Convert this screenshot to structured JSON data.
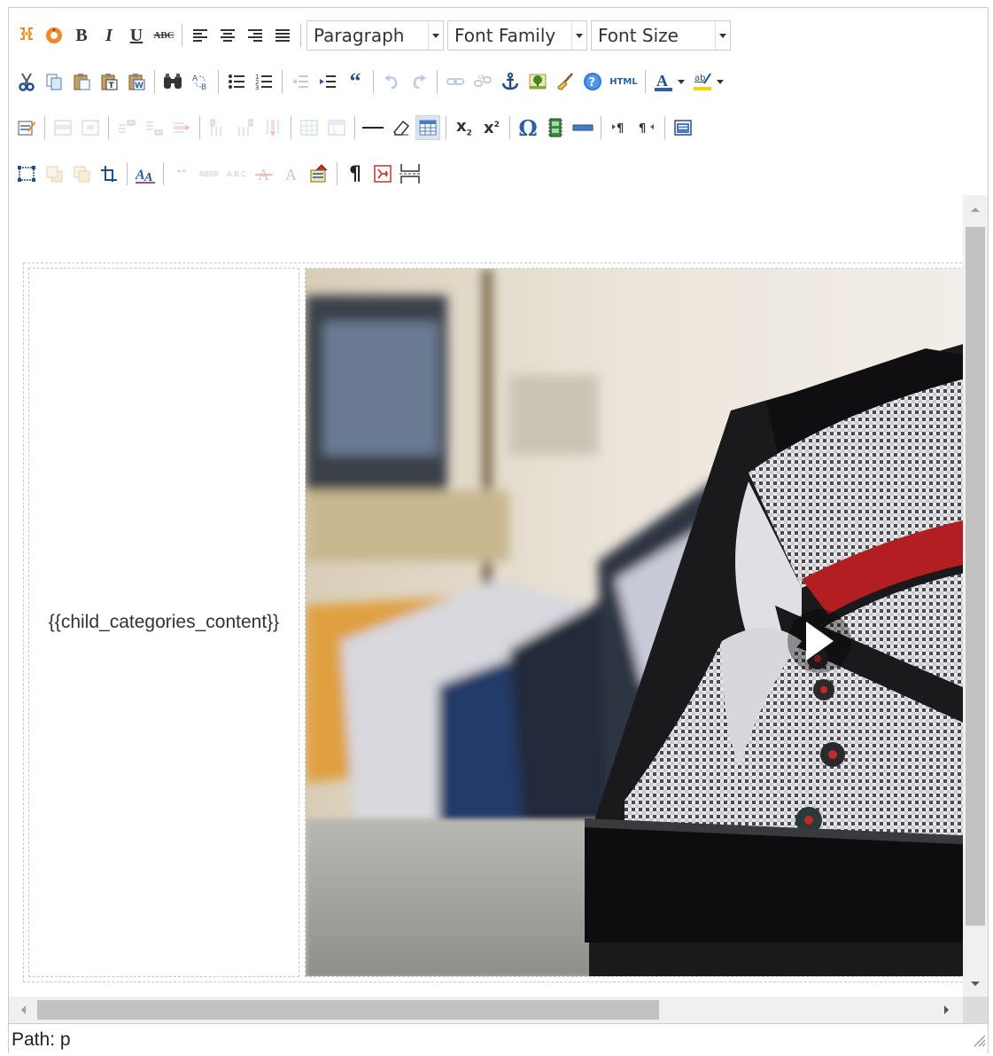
{
  "toolbar": {
    "format_select": "Paragraph",
    "font_family_select": "Font Family",
    "font_size_select": "Font Size",
    "html_label": "HTML",
    "bold_glyph": "B",
    "italic_glyph": "I",
    "underline_glyph": "U",
    "strike_glyph": "ABC",
    "omega_glyph": "Ω",
    "pilcrow_glyph": "¶"
  },
  "content": {
    "placeholder_text": "{{child_categories_content}}"
  },
  "statusbar": {
    "path_label": "Path: p"
  },
  "colors": {
    "accent_blue": "#2c5fa8",
    "text_color_bar": "#2c5fa8",
    "highlight_bar": "#f2d400",
    "border": "#cccccc",
    "scrollbar_thumb": "#c1c1c1"
  }
}
